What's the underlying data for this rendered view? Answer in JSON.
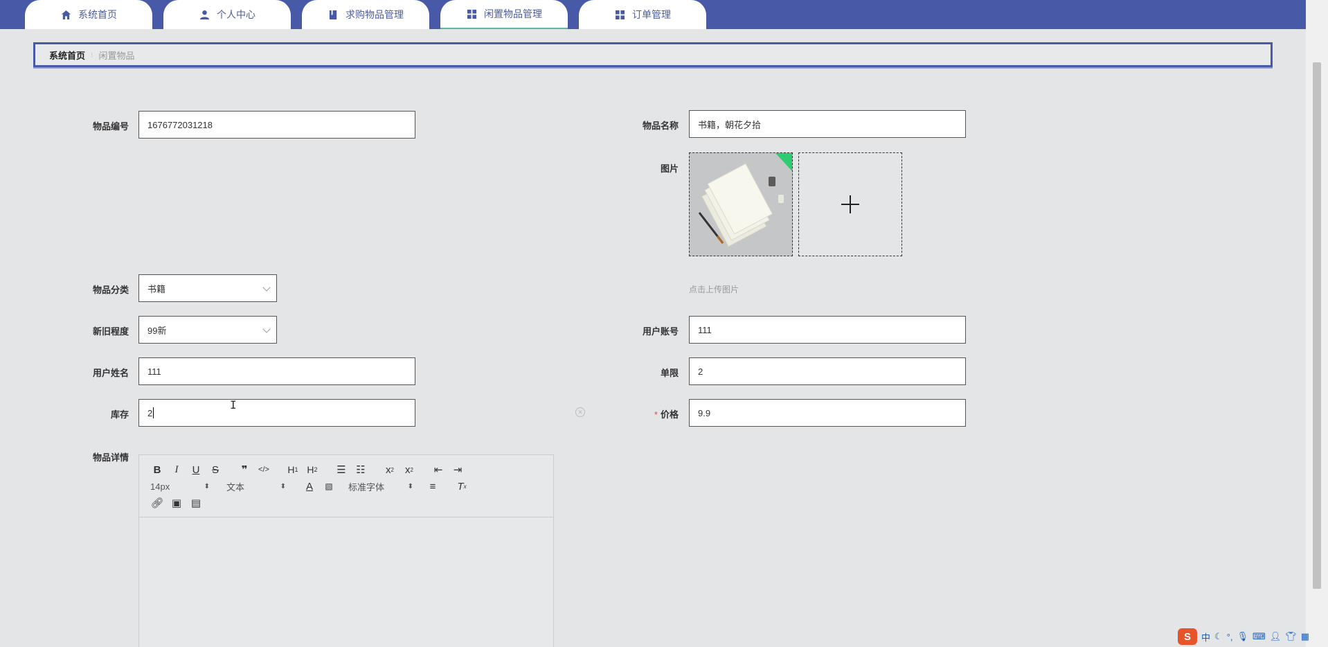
{
  "nav": {
    "tabs": [
      {
        "label": "系统首页",
        "icon": "home-icon"
      },
      {
        "label": "个人中心",
        "icon": "user-icon"
      },
      {
        "label": "求购物品管理",
        "icon": "book-icon"
      },
      {
        "label": "闲置物品管理",
        "icon": "grid-icon",
        "active": true
      },
      {
        "label": "订单管理",
        "icon": "grid-icon"
      }
    ]
  },
  "breadcrumb": {
    "home": "系统首页",
    "current": "闲置物品"
  },
  "form": {
    "item_no": {
      "label": "物品编号",
      "value": "1676772031218"
    },
    "item_name": {
      "label": "物品名称",
      "value": "书籍，朝花夕拾"
    },
    "image": {
      "label": "图片",
      "hint": "点击上传图片"
    },
    "category": {
      "label": "物品分类",
      "value": "书籍"
    },
    "condition": {
      "label": "新旧程度",
      "value": "99新"
    },
    "user_account": {
      "label": "用户账号",
      "value": "111"
    },
    "user_name": {
      "label": "用户姓名",
      "value": "111"
    },
    "limit": {
      "label": "单限",
      "value": "2"
    },
    "stock": {
      "label": "库存",
      "value": "2"
    },
    "price": {
      "label": "价格",
      "value": "9.9",
      "required_mark": "*"
    },
    "details": {
      "label": "物品详情"
    }
  },
  "editor": {
    "font_size": "14px",
    "heading": "文本",
    "font_family": "标准字体"
  },
  "tray": {
    "ime": "中"
  },
  "colors": {
    "nav": "#4759a7",
    "accent": "#5bb5a5",
    "required": "#e74c3c"
  }
}
